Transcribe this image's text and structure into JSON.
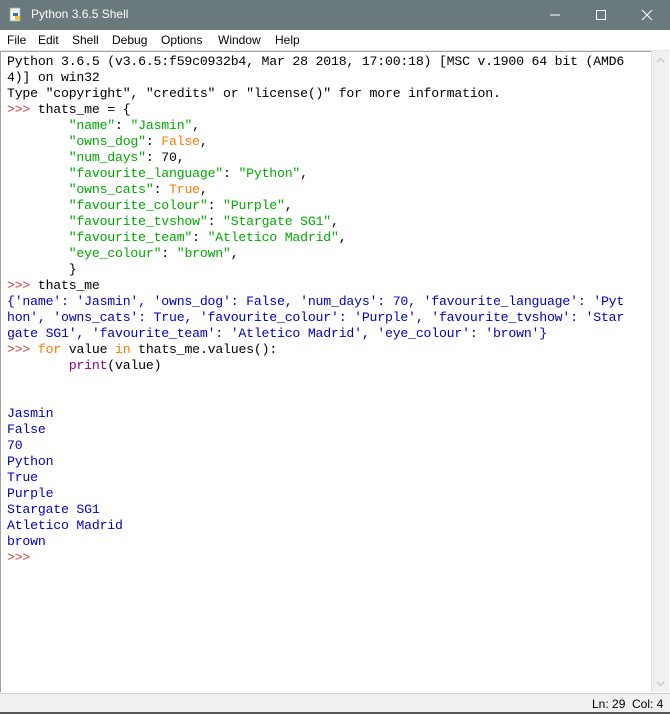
{
  "window": {
    "title": "Python 3.6.5 Shell",
    "icons": {
      "app": "python-idle-icon",
      "minimize": "minimize-icon",
      "maximize": "maximize-icon",
      "close": "close-icon"
    }
  },
  "menu": {
    "items": [
      "File",
      "Edit",
      "Shell",
      "Debug",
      "Options",
      "Window",
      "Help"
    ]
  },
  "shell": {
    "banner": [
      "Python 3.6.5 (v3.6.5:f59c0932b4, Mar 28 2018, 17:00:18) [MSC v.1900 64 bit (AMD6",
      "4)] on win32",
      "Type \"copyright\", \"credits\" or \"license()\" for more information."
    ],
    "prompt": ">>>",
    "input1": {
      "assign": " thats_me = {",
      "entries": [
        {
          "key": "\"name\"",
          "value": "\"Jasmin\"",
          "value_type": "string"
        },
        {
          "key": "\"owns_dog\"",
          "value": "False",
          "value_type": "keyword"
        },
        {
          "key": "\"num_days\"",
          "value": "70",
          "value_type": "number"
        },
        {
          "key": "\"favourite_language\"",
          "value": "\"Python\"",
          "value_type": "string"
        },
        {
          "key": "\"owns_cats\"",
          "value": "True",
          "value_type": "keyword"
        },
        {
          "key": "\"favourite_colour\"",
          "value": "\"Purple\"",
          "value_type": "string"
        },
        {
          "key": "\"favourite_tvshow\"",
          "value": "\"Stargate SG1\"",
          "value_type": "string"
        },
        {
          "key": "\"favourite_team\"",
          "value": "\"Atletico Madrid\"",
          "value_type": "string"
        },
        {
          "key": "\"eye_colour\"",
          "value": "\"brown\"",
          "value_type": "string"
        }
      ],
      "close": "}"
    },
    "input2": " thats_me",
    "output2": [
      "{'name': 'Jasmin', 'owns_dog': False, 'num_days': 70, 'favourite_language': 'Pyt",
      "hon', 'owns_cats': True, 'favourite_colour': 'Purple', 'favourite_tvshow': 'Star",
      "gate SG1', 'favourite_team': 'Atletico Madrid', 'eye_colour': 'brown'}"
    ],
    "input3": {
      "kw_for": "for",
      "mid": " value ",
      "kw_in": "in",
      "rest": " thats_me.values():",
      "builtin": "print",
      "args": "(value)"
    },
    "output3": [
      "Jasmin",
      "False",
      "70",
      "Python",
      "True",
      "Purple",
      "Stargate SG1",
      "Atletico Madrid",
      "brown"
    ],
    "final_prompt": ">>>"
  },
  "status": {
    "line": "Ln: 29",
    "col": "Col: 4"
  },
  "colors": {
    "titlebar": "#6a7a7c",
    "prompt": "#c00000",
    "string": "#00aa00",
    "keyword": "#ff7700",
    "builtin": "#900090",
    "stdout": "#0000c0"
  }
}
